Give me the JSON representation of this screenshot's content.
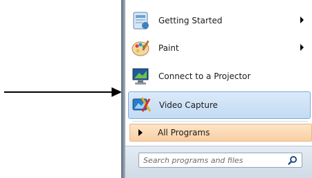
{
  "menu": {
    "items": [
      {
        "label": "Getting Started",
        "icon": "getting-started-icon",
        "has_submenu": true
      },
      {
        "label": "Paint",
        "icon": "paint-palette-icon",
        "has_submenu": true
      },
      {
        "label": "Connect to a Projector",
        "icon": "projector-icon",
        "has_submenu": false
      },
      {
        "label": "Video Capture",
        "icon": "video-capture-icon",
        "has_submenu": false,
        "selected": true
      }
    ],
    "all_programs_label": "All Programs"
  },
  "search": {
    "placeholder": "Search programs and files"
  },
  "colors": {
    "selected_bg": "#c3dbf4",
    "all_programs_bg": "#f9cfa3",
    "search_bar_bg": "#d0dbe7"
  }
}
